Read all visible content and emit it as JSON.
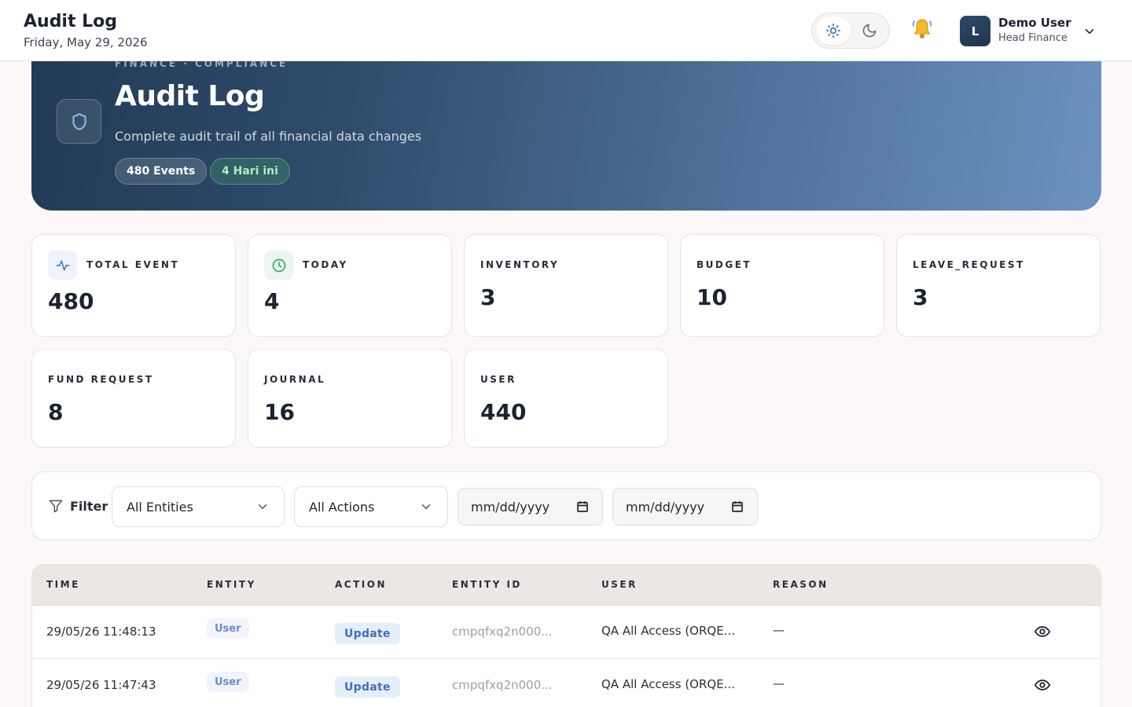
{
  "topbar": {
    "title": "Audit Log",
    "date": "Friday, May 29, 2026",
    "theme_light_icon": "sun-icon",
    "theme_dark_icon": "moon-icon",
    "notification_icon": "bell-icon",
    "user": {
      "initial": "L",
      "name": "Demo User",
      "role": "Head Finance"
    }
  },
  "hero": {
    "eyebrow": "FINANCE · COMPLIANCE",
    "title": "Audit Log",
    "subtitle": "Complete audit trail of all financial data changes",
    "events_pill": "480 Events",
    "today_pill": "4 Hari ini",
    "icon": "shield-icon"
  },
  "stats": [
    {
      "label": "TOTAL EVENT",
      "value": "480",
      "icon": "activity-icon"
    },
    {
      "label": "TODAY",
      "value": "4",
      "icon": "clock-icon"
    },
    {
      "label": "INVENTORY",
      "value": "3"
    },
    {
      "label": "BUDGET",
      "value": "10"
    },
    {
      "label": "LEAVE_REQUEST",
      "value": "3"
    },
    {
      "label": "FUND REQUEST",
      "value": "8"
    },
    {
      "label": "JOURNAL",
      "value": "16"
    },
    {
      "label": "USER",
      "value": "440"
    }
  ],
  "filters": {
    "label": "Filter",
    "entity_select": "All Entities",
    "action_select": "All Actions",
    "date_from_placeholder": "mm/dd/yyyy",
    "date_to_placeholder": "mm/dd/yyyy"
  },
  "table": {
    "columns": [
      "TIME",
      "ENTITY",
      "ACTION",
      "ENTITY ID",
      "USER",
      "REASON"
    ],
    "rows": [
      {
        "time": "29/05/26 11:48:13",
        "entity": "User",
        "action": "Update",
        "entity_id": "cmpqfxq2n000...",
        "user": "QA All Access (ORQE...",
        "reason": "—"
      },
      {
        "time": "29/05/26 11:47:43",
        "entity": "User",
        "action": "Update",
        "entity_id": "cmpqfxq2n000...",
        "user": "QA All Access (ORQE...",
        "reason": "—"
      }
    ]
  },
  "colors": {
    "accent": "#3f6fc0",
    "hero_start": "#213a55",
    "hero_end": "#6c92c0",
    "today_green": "#a8f0c0"
  }
}
